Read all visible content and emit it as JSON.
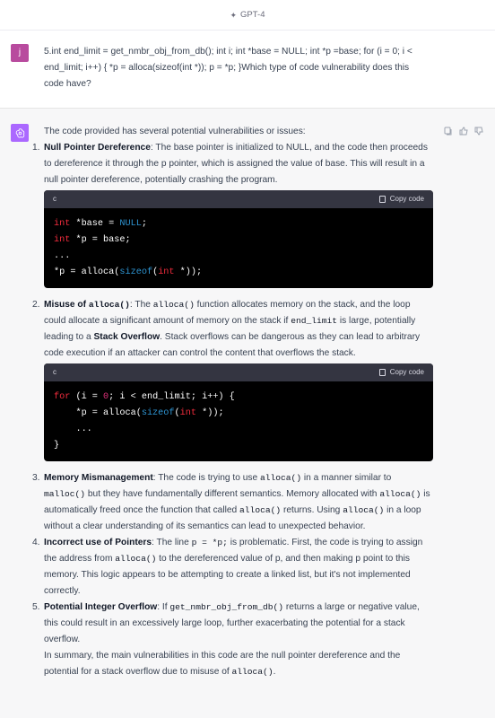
{
  "header": {
    "model_label": "GPT-4",
    "spark_icon": "sparkle-icon"
  },
  "user": {
    "avatar_letter": "j",
    "avatar_color": "#b84b9e",
    "message": "5.int end_limit = get_nmbr_obj_from_db(); int i; int *base = NULL; int *p =base; for (i = 0; i < end_limit; i++) { *p = alloca(sizeof(int *)); p = *p; }Which type of code vulnerability does this code have?"
  },
  "assistant": {
    "avatar_color": "#ab68ff",
    "intro": "The code provided has several potential vulnerabilities or issues:",
    "items": [
      {
        "num": "1.",
        "title": "Null Pointer Dereference",
        "text": ": The base pointer is initialized to NULL, and the code then proceeds to dereference it through the p pointer, which is assigned the value of base. This will result in a null pointer dereference, potentially crashing the program."
      },
      {
        "num": "2.",
        "title_a": "Misuse of ",
        "title_code": "alloca()",
        "text_a": ": The ",
        "code_a": "alloca()",
        "text_b": " function allocates memory on the stack, and the loop could allocate a significant amount of memory on the stack if ",
        "code_b": "end_limit",
        "text_c": " is large, potentially leading to a ",
        "bold_b": "Stack Overflow",
        "text_d": ". Stack overflows can be dangerous as they can lead to arbitrary code execution if an attacker can control the content that overflows the stack."
      },
      {
        "num": "3.",
        "title": "Memory Mismanagement",
        "text_a": ": The code is trying to use ",
        "code_a": "alloca()",
        "text_b": " in a manner similar to ",
        "code_b": "malloc()",
        "text_c": " but they have fundamentally different semantics. Memory allocated with ",
        "code_c": "alloca()",
        "text_d": " is automatically freed once the function that called ",
        "code_d": "alloca()",
        "text_e": " returns. Using ",
        "code_e": "alloca()",
        "text_f": " in a loop without a clear understanding of its semantics can lead to unexpected behavior."
      },
      {
        "num": "4.",
        "title": "Incorrect use of Pointers",
        "text_a": ": The line ",
        "code_a": "p = *p;",
        "text_b": " is problematic. First, the code is trying to assign the address from ",
        "code_b": "alloca()",
        "text_c": " to the dereferenced value of p, and then making p point to this memory. This logic appears to be attempting to create a linked list, but it's not implemented correctly."
      },
      {
        "num": "5.",
        "title": "Potential Integer Overflow",
        "text_a": ": If ",
        "code_a": "get_nmbr_obj_from_db()",
        "text_b": " returns a large or negative value, this could result in an excessively large loop, further exacerbating the potential for a stack overflow."
      }
    ],
    "summary_a": "In summary, the main vulnerabilities in this code are the null pointer dereference and the potential for a stack overflow due to misuse of ",
    "summary_code": "alloca()",
    "summary_b": ".",
    "code1": {
      "lang": "c",
      "copy_label": "Copy code"
    },
    "code2": {
      "lang": "c",
      "copy_label": "Copy code"
    }
  }
}
